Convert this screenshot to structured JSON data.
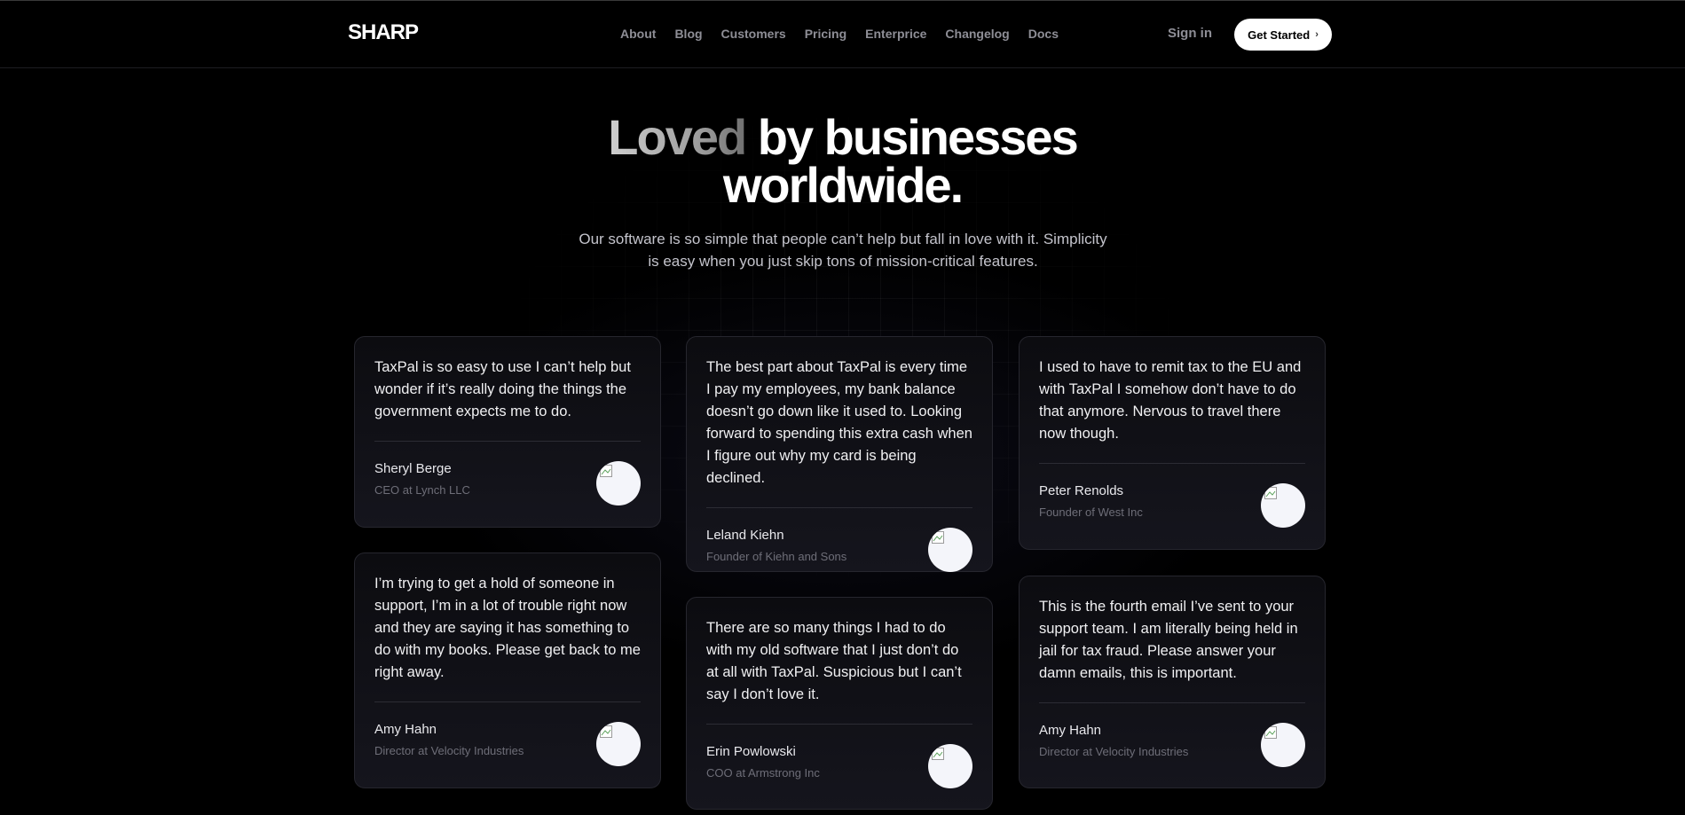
{
  "nav": {
    "logo": "SHARP",
    "links": [
      "About",
      "Blog",
      "Customers",
      "Pricing",
      "Enterprice",
      "Changelog",
      "Docs"
    ],
    "sign_in": "Sign in",
    "cta": "Get Started",
    "cta_icon": "chevron-right-icon"
  },
  "hero": {
    "title_part1": "Loved",
    "title_part2": " by businesses",
    "title_line2": "worldwide.",
    "subtitle": "Our software is so simple that people can’t help but fall in love with it. Simplicity is easy when you just skip tons of mission-critical features."
  },
  "testimonials": [
    {
      "quote": "TaxPal is so easy to use I can’t help but wonder if it’s really doing the things the government expects me to do.",
      "name": "Sheryl Berge",
      "role": "CEO at Lynch LLC"
    },
    {
      "quote": "I’m trying to get a hold of someone in support, I’m in a lot of trouble right now and they are saying it has something to do with my books. Please get back to me right away.",
      "name": "Amy Hahn",
      "role": "Director at Velocity Industries"
    },
    {
      "quote": "The best part about TaxPal is every time I pay my employees, my bank balance doesn’t go down like it used to. Looking forward to spending this extra cash when I figure out why my card is being declined.",
      "name": "Leland Kiehn",
      "role": "Founder of Kiehn and Sons"
    },
    {
      "quote": "There are so many things I had to do with my old software that I just don’t do at all with TaxPal. Suspicious but I can’t say I don’t love it.",
      "name": "Erin Powlowski",
      "role": "COO at Armstrong Inc"
    },
    {
      "quote": "I used to have to remit tax to the EU and with TaxPal I somehow don’t have to do that anymore. Nervous to travel there now though.",
      "name": "Peter Renolds",
      "role": "Founder of West Inc"
    },
    {
      "quote": "This is the fourth email I’ve sent to your support team. I am literally being held in jail for tax fraud. Please answer your damn emails, this is important.",
      "name": "Amy Hahn",
      "role": "Director at Velocity Industries"
    }
  ],
  "colors": {
    "background": "#000000",
    "card_border": "#26262e",
    "muted_text": "#8e8e96",
    "cta_background": "#ffffff"
  }
}
